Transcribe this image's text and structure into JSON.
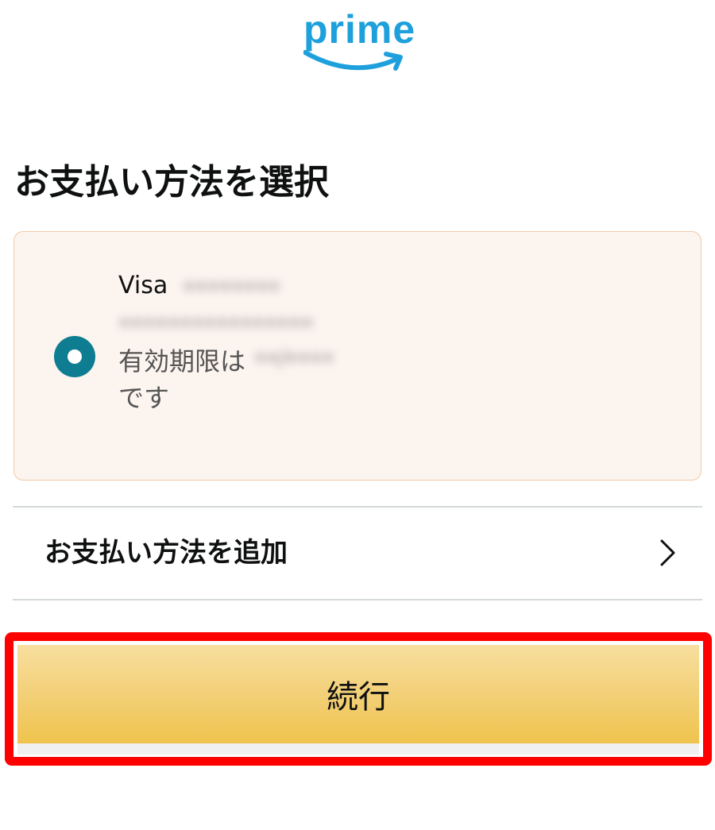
{
  "brand": {
    "logo_text": "prime",
    "color": "#1ea0dc"
  },
  "page": {
    "title": "お支払い方法を選択"
  },
  "payment_method": {
    "selected": true,
    "brand": "Visa",
    "holder_redacted": "••••••••",
    "number_redacted": "••••••••••••••••",
    "expiry_label": "有効期限は",
    "expiry_redacted": "••/••••",
    "expiry_suffix": "です",
    "radio_color": "#0e7c91",
    "card_background": "#fcf4ef"
  },
  "add_payment": {
    "label": "お支払い方法を追加",
    "icon": "chevron-right-icon"
  },
  "continue_button": {
    "label": "続行",
    "highlight_color": "#ff0000"
  }
}
